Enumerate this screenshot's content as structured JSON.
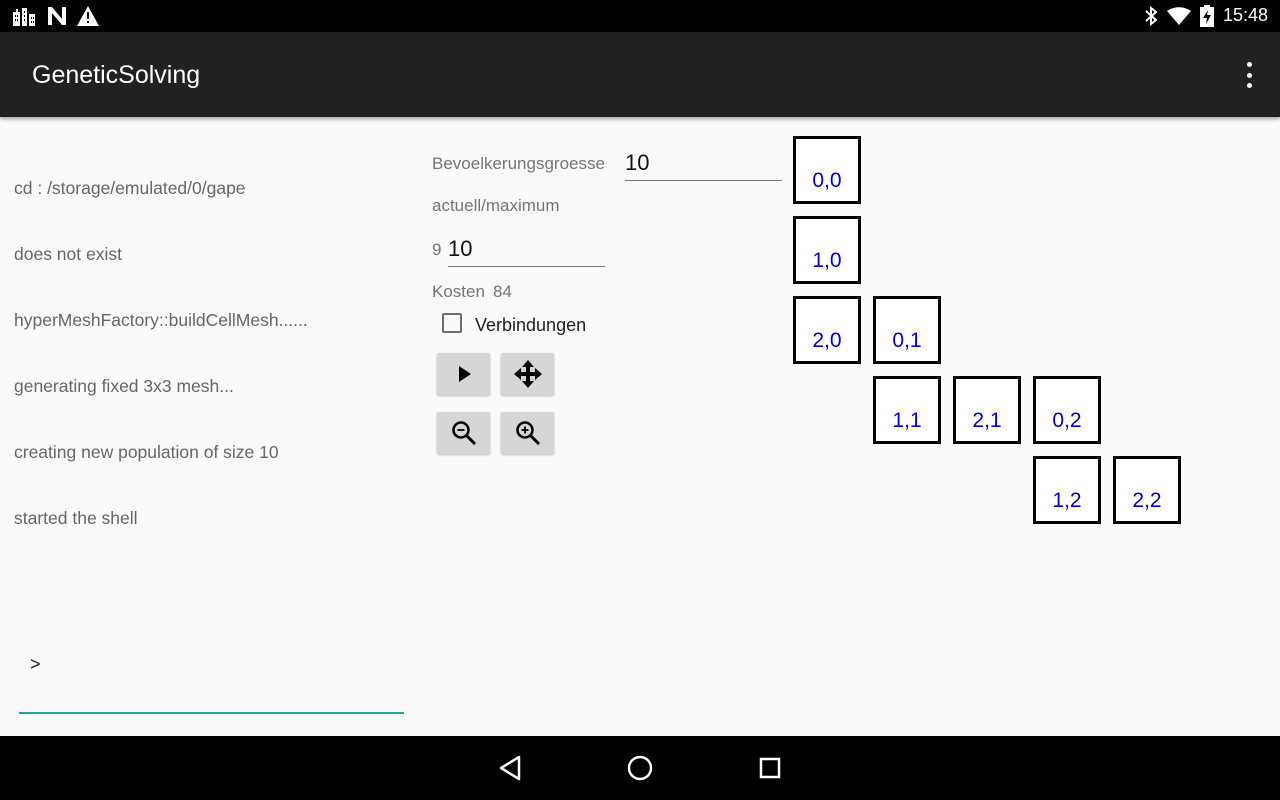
{
  "status_bar": {
    "time": "15:48",
    "left_icons": [
      "city-icon",
      "n-icon",
      "warning-icon"
    ],
    "right_icons": [
      "bluetooth-icon",
      "wifi-icon",
      "battery-charging-icon"
    ]
  },
  "app_bar": {
    "title": "GeneticSolving",
    "menu_icon": "overflow-menu-icon"
  },
  "console": {
    "log_lines": [
      "cd : /storage/emulated/0/gape",
      "does not exist",
      "hyperMeshFactory::buildCellMesh......",
      "generating fixed 3x3 mesh...",
      "creating new population of size 10",
      "started the shell"
    ],
    "prompt": ">",
    "input_value": ""
  },
  "controls": {
    "population_label": "Bevoelkerungsgroesse",
    "population_value": "10",
    "generation_label": "actuell/maximum",
    "generation_current": "9",
    "generation_max": "10",
    "cost_label": "Kosten",
    "cost_value": "84",
    "connections_label": "Verbindungen",
    "connections_checked": false,
    "buttons": [
      "play-icon",
      "move-icon",
      "zoom-out-icon",
      "zoom-in-icon"
    ]
  },
  "mesh": {
    "cells": [
      {
        "label": "0,0"
      },
      {
        "label": "1,0"
      },
      {
        "label": "2,0"
      },
      {
        "label": "0,1"
      },
      {
        "label": "1,1"
      },
      {
        "label": "2,1"
      },
      {
        "label": "0,2"
      },
      {
        "label": "1,2"
      },
      {
        "label": "2,2"
      }
    ]
  },
  "nav_bar": {
    "buttons": [
      "back-icon",
      "home-icon",
      "recents-icon"
    ]
  },
  "colors": {
    "status_bar": "#000000",
    "app_bar": "#212121",
    "background": "#fafafa",
    "accent": "#26a69a",
    "cell_label": "#0000cc",
    "button": "#d6d6d6"
  }
}
